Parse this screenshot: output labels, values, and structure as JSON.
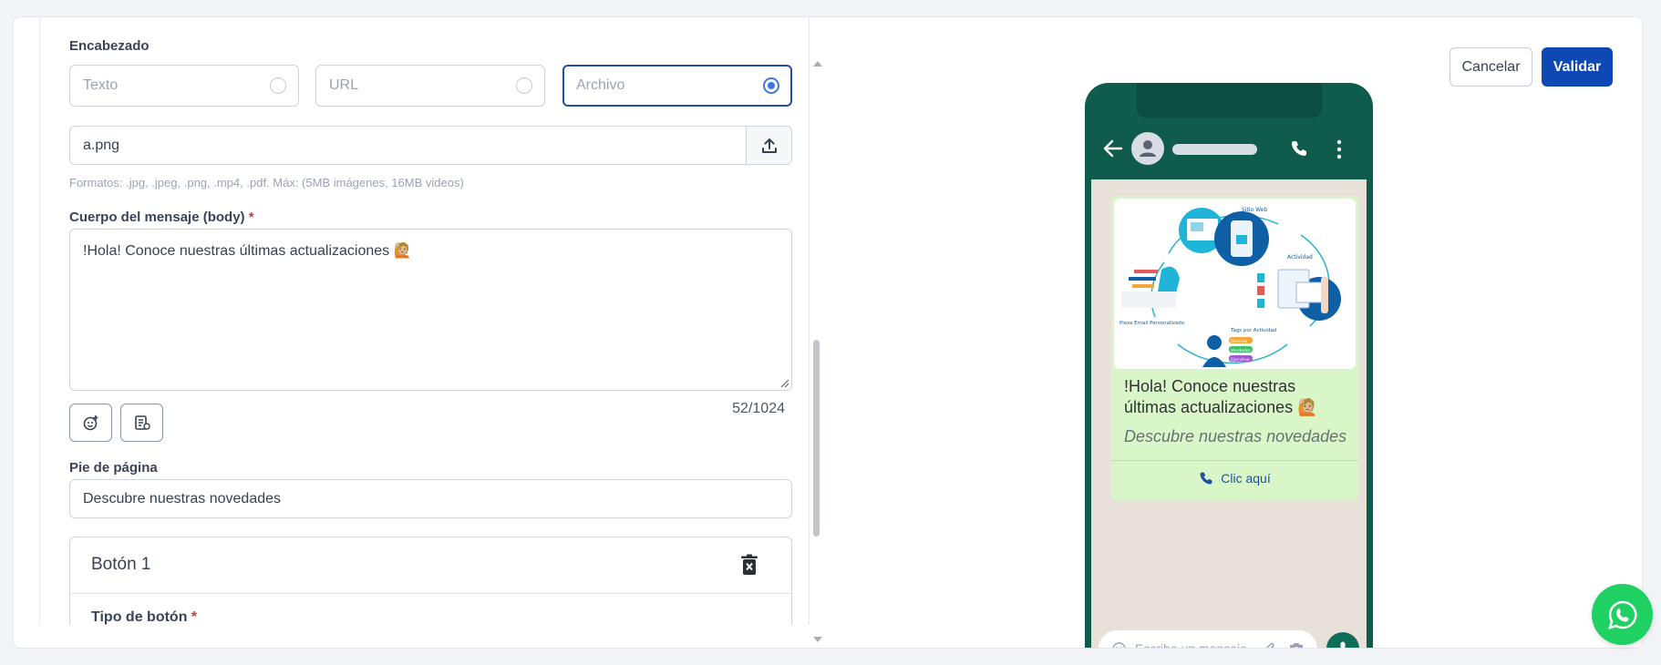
{
  "form": {
    "header_label": "Encabezado",
    "header_options": [
      {
        "label": "Texto",
        "selected": false
      },
      {
        "label": "URL",
        "selected": false
      },
      {
        "label": "Archivo",
        "selected": true
      }
    ],
    "file_name": "a.png",
    "formats_hint": "Formatos: .jpg, .jpeg, .png, .mp4, .pdf. Máx: (5MB imágenes, 16MB videos)",
    "body_label": "Cuerpo del mensaje (body)",
    "required_mark": "*",
    "body_value": "!Hola! Conoce nuestras últimas actualizaciones 🙋🏼",
    "char_counter": "52/1024",
    "footer_label": "Pie de página",
    "footer_value": "Descubre nuestras novedades",
    "button_card": {
      "title": "Botón 1",
      "type_label": "Tipo de botón"
    }
  },
  "actions": {
    "cancel_label": "Cancelar",
    "validate_label": "Validar"
  },
  "preview": {
    "message": "!Hola! Conoce nuestras últimas actualizaciones 🙋🏼",
    "footer": "Descubre nuestras novedades",
    "cta_label": "Clic aquí",
    "compose_placeholder": "Escribe un mensaje...",
    "image_labels": {
      "site": "Sitio Web",
      "activity": "Actividad",
      "email": "Pieza Email Personalizado",
      "tags": "Tags por Actividad",
      "chip1": "Gerente",
      "chip2": "Vendedor",
      "chip3": "Ejecutivo"
    }
  },
  "colors": {
    "primary": "#0e48b4",
    "whatsapp_dark": "#0f5c4c",
    "bubble": "#d9f6c8",
    "fab": "#1fd163"
  }
}
